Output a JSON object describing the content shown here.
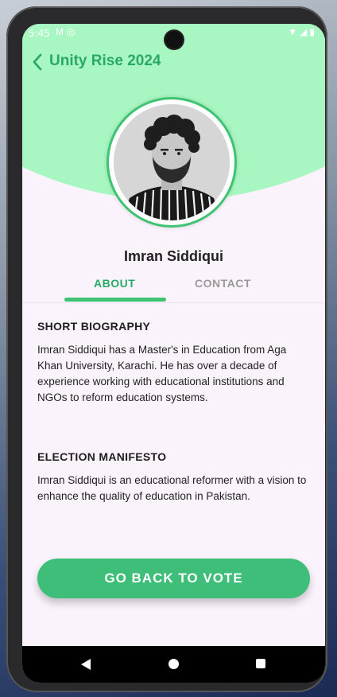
{
  "status_bar": {
    "time": "5:45",
    "left_icons": [
      "gmail-icon",
      "sync-icon"
    ],
    "right_icons": [
      "wifi-icon",
      "signal-icon",
      "battery-icon"
    ]
  },
  "app_bar": {
    "title": "Unity Rise 2024",
    "back_icon": "chevron-left-icon"
  },
  "profile": {
    "name": "Imran Siddiqui"
  },
  "tabs": [
    {
      "label": "ABOUT",
      "active": true
    },
    {
      "label": "CONTACT",
      "active": false
    }
  ],
  "sections": [
    {
      "title": "SHORT BIOGRAPHY",
      "text": "Imran Siddiqui has a Master's in Education from Aga Khan University, Karachi. He has over a decade of experience working with educational institutions and NGOs to reform education systems."
    },
    {
      "title": "ELECTION MANIFESTO",
      "text": "Imran Siddiqui is an educational reformer with a vision to enhance the quality of education in Pakistan."
    }
  ],
  "action": {
    "label": "GO BACK TO VOTE"
  },
  "colors": {
    "accent": "#2aa866",
    "header_bg": "#a8f7c2",
    "button": "#3ebe78",
    "background": "#fbf3fc"
  }
}
